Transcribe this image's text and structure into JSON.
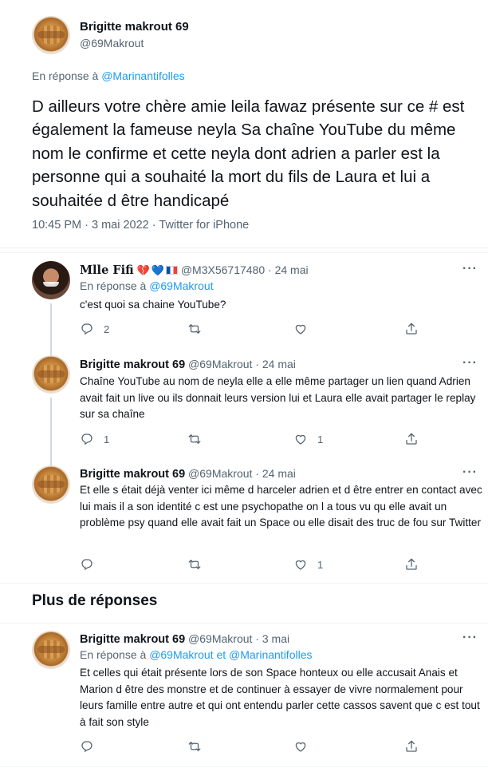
{
  "main_tweet": {
    "display_name": "Brigitte makrout 69",
    "handle": "@69Makrout",
    "reply_prefix": "En réponse à",
    "reply_to": "@Marinantifolles",
    "text": "D ailleurs votre chère amie leila fawaz présente sur ce # est également la fameuse neyla Sa chaîne YouTube du même nom le confirme et cette neyla dont adrien a parler est la personne qui a souhaité la mort du fils de Laura et lui a souhaitée d être handicapé",
    "time": "10:45 PM",
    "date": "3 mai 2022",
    "source": "Twitter for iPhone",
    "meta_sep": "·"
  },
  "replies": [
    {
      "display_name": "Mlle Fifi",
      "emoji_broken_heart": "💔",
      "emoji_blue_heart": "💙",
      "handle": "@M3X56717480",
      "date": "24 mai",
      "reply_prefix": "En réponse à",
      "reply_to": "@69Makrout",
      "text": "c'est quoi sa chaine YouTube?",
      "reply_count": "2",
      "retweet_count": "",
      "like_count": "",
      "more": "···"
    },
    {
      "display_name": "Brigitte makrout 69",
      "handle": "@69Makrout",
      "date": "24 mai",
      "text": "Chaîne YouTube au nom de neyla elle a elle même partager un lien quand Adrien avait fait un live ou ils donnait leurs version lui et Laura elle avait partager le replay sur sa chaîne",
      "reply_count": "1",
      "retweet_count": "",
      "like_count": "1",
      "more": "···"
    },
    {
      "display_name": "Brigitte makrout 69",
      "handle": "@69Makrout",
      "date": "24 mai",
      "text": "Et elle s était déjà venter ici même  d harceler adrien et d être entrer en contact avec lui mais il a son identité c est une psychopathe on l a tous vu qu elle avait un problème psy quand elle avait fait un Space ou elle disait des truc de fou sur Twitter",
      "reply_count": "",
      "retweet_count": "",
      "like_count": "1",
      "more": "···"
    }
  ],
  "more_replies": {
    "heading": "Plus de réponses",
    "tweet": {
      "display_name": "Brigitte makrout 69",
      "handle": "@69Makrout",
      "date": "3 mai",
      "reply_prefix": "En réponse à",
      "reply_to_1": "@69Makrout",
      "reply_and": "et",
      "reply_to_2": "@Marinantifolles",
      "text": "Et celles qui était présente lors de son Space honteux ou elle accusait Anais et Marion d être des monstre et de continuer à essayer de vivre normalement pour leurs famille entre autre et qui ont entendu parler cette cassos savent que c est tout à fait son style",
      "more": "···"
    }
  },
  "icons": {
    "reply": "reply-icon",
    "retweet": "retweet-icon",
    "like": "like-icon",
    "share": "share-icon",
    "more": "more-icon"
  },
  "colors": {
    "link": "#1d9bf0",
    "muted": "#536471",
    "text": "#0f1419",
    "divider": "#eff3f4"
  }
}
